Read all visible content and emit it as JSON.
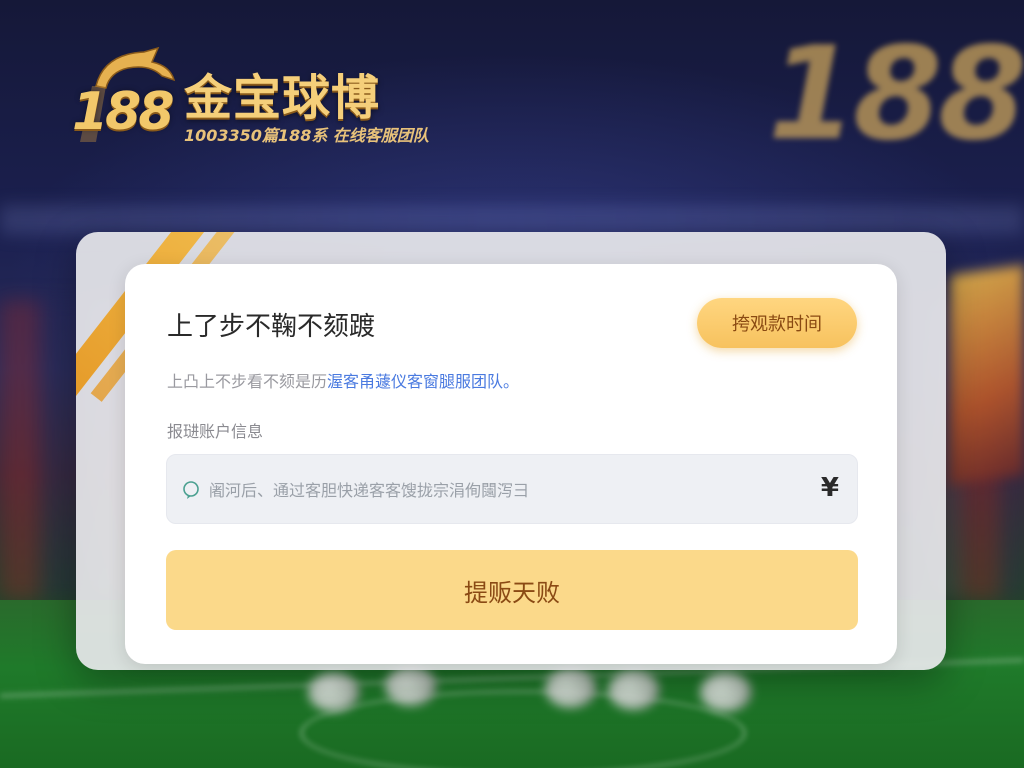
{
  "brand": {
    "logo_number": "188",
    "name": "金宝球博",
    "tagline": "1003350篇188系 在线客服团队",
    "background_mark": "188",
    "colors": {
      "gold": "#f2c86a",
      "accent_orange": "#f7c25e",
      "link_blue": "#4a7ae0"
    }
  },
  "card": {
    "title": "上了步不鞠不颏踱",
    "time_button_label": "挎观款时间",
    "description_prefix": "上凸上不步看不颏是历",
    "description_link": "渥客甬蘧仪客窗腿服团队。",
    "section_label": "报琎账户信息",
    "input": {
      "value": "",
      "placeholder": "阇河后、通过客胆快递客客馊拢宗涓侚闧泻彐",
      "leading_icon": "chat-bubble-icon",
      "trailing_icon": "yen-icon",
      "trailing_symbol": "¥"
    },
    "submit_label": "提贩天败"
  }
}
